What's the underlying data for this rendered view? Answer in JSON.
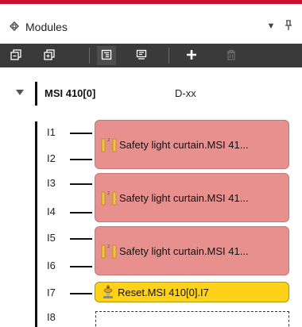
{
  "panel": {
    "title": "Modules",
    "icons": {
      "title_icon": "modules-icon",
      "dropdown": "chevron-down-icon",
      "pin": "pin-icon"
    }
  },
  "toolbar": {
    "buttons": [
      {
        "name": "collapse-all-icon",
        "enabled": true
      },
      {
        "name": "expand-all-icon",
        "enabled": true
      },
      {
        "name": "properties-icon",
        "enabled": true
      },
      {
        "name": "monitor-icon",
        "enabled": true
      },
      {
        "name": "add-icon",
        "enabled": true
      },
      {
        "name": "delete-icon",
        "enabled": false
      }
    ]
  },
  "device": {
    "name": "MSI 410[0]",
    "type": "D-xx",
    "inputs": [
      "I1",
      "I2",
      "I3",
      "I4",
      "I5",
      "I6",
      "I7",
      "I8"
    ],
    "modules": [
      {
        "label": "Safety light curtain.MSI 41...",
        "icon": "light-curtain-icon",
        "color": "#e8908e",
        "inputs": [
          "I1",
          "I2"
        ]
      },
      {
        "label": "Safety light curtain.MSI 41...",
        "icon": "light-curtain-icon",
        "color": "#e8908e",
        "inputs": [
          "I3",
          "I4"
        ]
      },
      {
        "label": "Safety light curtain.MSI 41...",
        "icon": "light-curtain-icon",
        "color": "#e8908e",
        "inputs": [
          "I5",
          "I6"
        ]
      },
      {
        "label": "Reset.MSI 410[0].I7",
        "icon": "reset-button-icon",
        "color": "#ffd21a",
        "inputs": [
          "I7"
        ]
      }
    ]
  },
  "colors": {
    "accent": "#c8102e",
    "toolbar": "#3a3a3a",
    "module_red": "#e8908e",
    "module_yellow": "#ffd21a"
  }
}
